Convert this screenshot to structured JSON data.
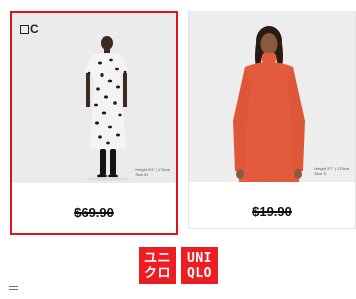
{
  "products": [
    {
      "brand_tag": "C",
      "price": "$69.90",
      "model_note_line1": "Height 5'9\" | 175cm",
      "model_note_line2": "Size M",
      "selected": true
    },
    {
      "price": "$19.90",
      "model_note_line1": "Height 5'7\" | 170cm",
      "model_note_line2": "Size S",
      "selected": false
    }
  ],
  "logo": {
    "left_line1": "ユニ",
    "left_line2": "クロ",
    "right_line1": "UNI",
    "right_line2": "QLO"
  },
  "colors": {
    "accent": "#e0141c",
    "logo_red": "#ed1d24"
  },
  "icons": [
    "menu-icon"
  ]
}
